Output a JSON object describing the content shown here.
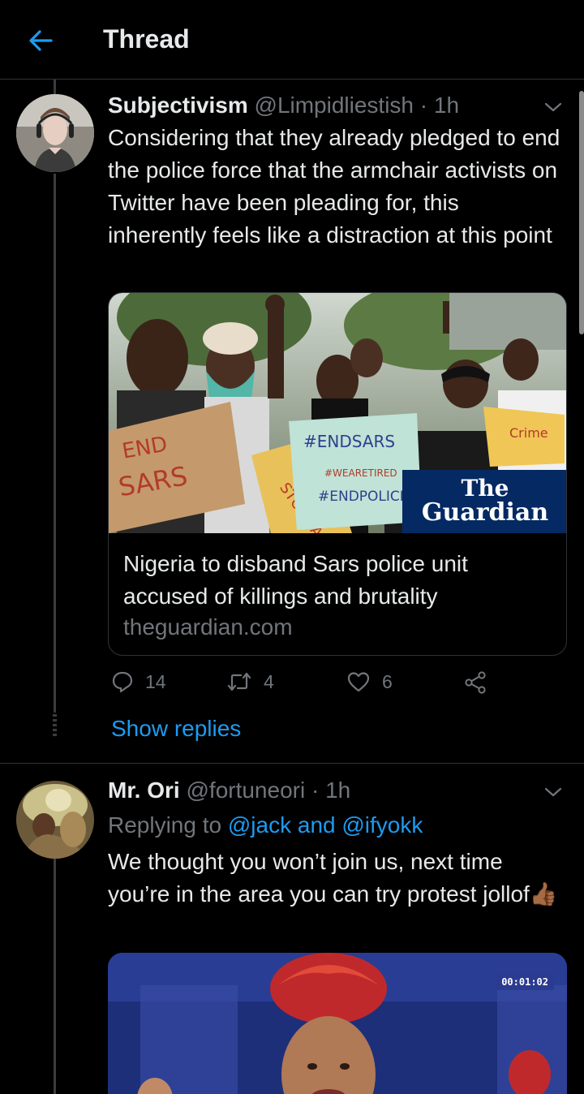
{
  "header": {
    "title": "Thread",
    "back_icon": "arrow-left-icon"
  },
  "tweets": [
    {
      "name": "Subjectivism",
      "handle": "@Limpidliestish",
      "time": "· 1h",
      "text": "Considering that they already pledged to end the police force that the armchair activists on Twitter have been pleading for, this inherently feels like a distraction at this point",
      "card": {
        "title": "Nigeria to disband Sars police unit accused of killings and brutality",
        "domain": "theguardian.com",
        "image": {
          "logo_line1": "The",
          "logo_line2": "Guardian",
          "sign1_line1": "END",
          "sign1_line2": "SARS",
          "sign2_line1": "#ENDSARS",
          "sign2_line2": "#WEARETIRED",
          "sign2_line3": "#ENDPOLICE",
          "sign3": "Crime",
          "sign4": "STOP SA"
        }
      },
      "actions": {
        "replies": "14",
        "retweets": "4",
        "likes": "6"
      },
      "show_replies": "Show replies"
    },
    {
      "name": "Mr. Ori",
      "handle": "@fortuneori",
      "time": "· 1h",
      "replying_prefix": "Replying to ",
      "replying_users": "@jack and @ifyokk",
      "text": "We thought you won’t join us, next time you’re in the area you can try protest jollof👍🏾",
      "media": {
        "timecode": "00:01:02"
      }
    }
  ],
  "colors": {
    "accent": "#1d9bf0",
    "muted": "#71767b",
    "text": "#e7e9ea",
    "background": "#000000",
    "border": "#2f3336"
  }
}
